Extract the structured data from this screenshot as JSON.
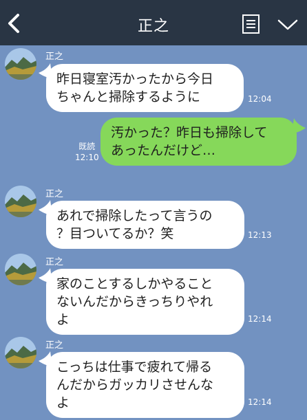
{
  "header": {
    "title": "正之"
  },
  "messages": [
    {
      "sender": "正之",
      "line1": "昨日寝室汚かったから今日",
      "line2": "ちゃんと掃除するように",
      "time": "12:04"
    },
    {
      "line1": "汚かった？昨日も掃除して",
      "line2": "あったんだけど…",
      "read": "既読",
      "time": "12:10"
    },
    {
      "sender": "正之",
      "line1": "あれで掃除したって言うの",
      "line2": "？目ついてるか？笑",
      "time": "12:13"
    },
    {
      "sender": "正之",
      "line1": "家のことするしかやること",
      "line2": "ないんだからきっちりやれ",
      "line3": "よ",
      "time": "12:14"
    },
    {
      "sender": "正之",
      "line1": "こっちは仕事で疲れて帰る",
      "line2": "んだからガッカリさせんな",
      "line3": "よ",
      "time": "12:14"
    }
  ],
  "icons": {
    "back": "back-arrow-icon",
    "menu": "note-menu-icon",
    "more": "chevron-down-icon"
  },
  "colors": {
    "header": "#293544",
    "background": "#7292c1",
    "incoming_bubble": "#ffffff",
    "outgoing_bubble": "#86d85a"
  }
}
